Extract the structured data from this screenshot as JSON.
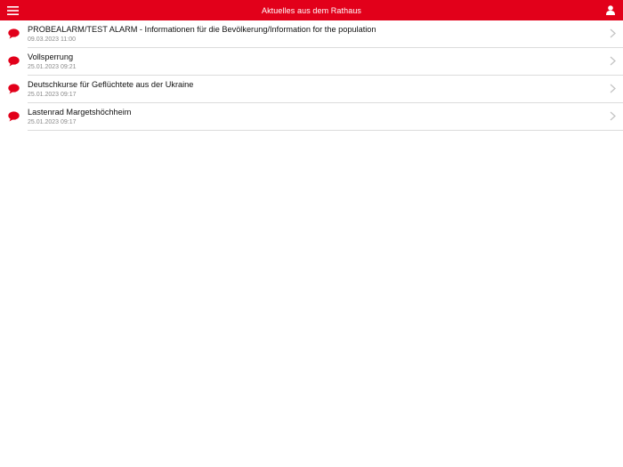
{
  "colors": {
    "accent": "#e2001a",
    "divider": "#dcdcdc",
    "date": "#8a8a8a",
    "chevron": "#c4c4c4"
  },
  "header": {
    "title": "Aktuelles aus dem Rathaus",
    "menu_icon": "hamburger-menu-icon",
    "user_icon": "user-icon"
  },
  "news": {
    "item_icon": "speech-bubble-icon",
    "items": [
      {
        "title": "PROBEALARM/TEST ALARM - Informationen für die Bevölkerung/Information for the population",
        "date": "09.03.2023 11:00"
      },
      {
        "title": "Vollsperrung",
        "date": "25.01.2023 09:21"
      },
      {
        "title": "Deutschkurse für Geflüchtete aus der Ukraine",
        "date": "25.01.2023 09:17"
      },
      {
        "title": "Lastenrad Margetshöchheim",
        "date": "25.01.2023 09:17"
      }
    ]
  }
}
